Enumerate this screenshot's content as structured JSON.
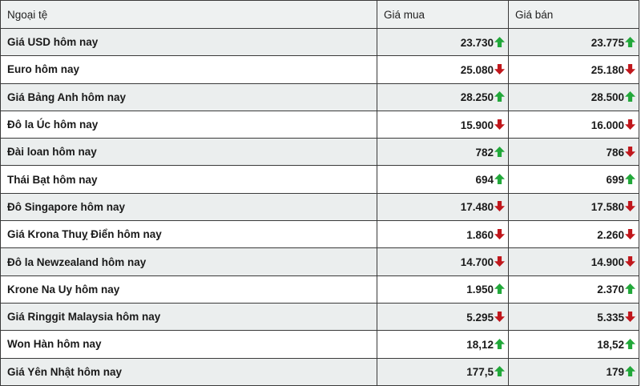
{
  "header": {
    "currency": "Ngoại tệ",
    "buy": "Giá mua",
    "sell": "Giá bán"
  },
  "colors": {
    "up": "#22a83a",
    "down": "#c0171c"
  },
  "rows": [
    {
      "name": "Giá USD hôm nay",
      "buy": "23.730",
      "buy_dir": "up",
      "sell": "23.775",
      "sell_dir": "up"
    },
    {
      "name": "Euro hôm nay",
      "buy": "25.080",
      "buy_dir": "down",
      "sell": "25.180",
      "sell_dir": "down"
    },
    {
      "name": "Giá Bảng Anh hôm nay",
      "buy": "28.250",
      "buy_dir": "up",
      "sell": "28.500",
      "sell_dir": "up"
    },
    {
      "name": "Đô la Úc hôm nay",
      "buy": "15.900",
      "buy_dir": "down",
      "sell": "16.000",
      "sell_dir": "down"
    },
    {
      "name": "Đài loan hôm nay",
      "buy": "782",
      "buy_dir": "up",
      "sell": "786",
      "sell_dir": "down"
    },
    {
      "name": "Thái Bạt hôm nay",
      "buy": "694",
      "buy_dir": "up",
      "sell": "699",
      "sell_dir": "up"
    },
    {
      "name": "Đô Singapore hôm nay",
      "buy": "17.480",
      "buy_dir": "down",
      "sell": "17.580",
      "sell_dir": "down"
    },
    {
      "name": "Giá Krona Thuỵ Điển hôm nay",
      "buy": "1.860",
      "buy_dir": "down",
      "sell": "2.260",
      "sell_dir": "down"
    },
    {
      "name": "Đô la Newzealand hôm nay",
      "buy": "14.700",
      "buy_dir": "down",
      "sell": "14.900",
      "sell_dir": "down"
    },
    {
      "name": "Krone Na Uy hôm nay",
      "buy": "1.950",
      "buy_dir": "up",
      "sell": "2.370",
      "sell_dir": "up"
    },
    {
      "name": "Giá Ringgit Malaysia hôm nay",
      "buy": "5.295",
      "buy_dir": "down",
      "sell": "5.335",
      "sell_dir": "down"
    },
    {
      "name": "Won Hàn hôm nay",
      "buy": "18,12",
      "buy_dir": "up",
      "sell": "18,52",
      "sell_dir": "up"
    },
    {
      "name": "Giá Yên Nhật hôm nay",
      "buy": "177,5",
      "buy_dir": "up",
      "sell": "179",
      "sell_dir": "up"
    }
  ]
}
